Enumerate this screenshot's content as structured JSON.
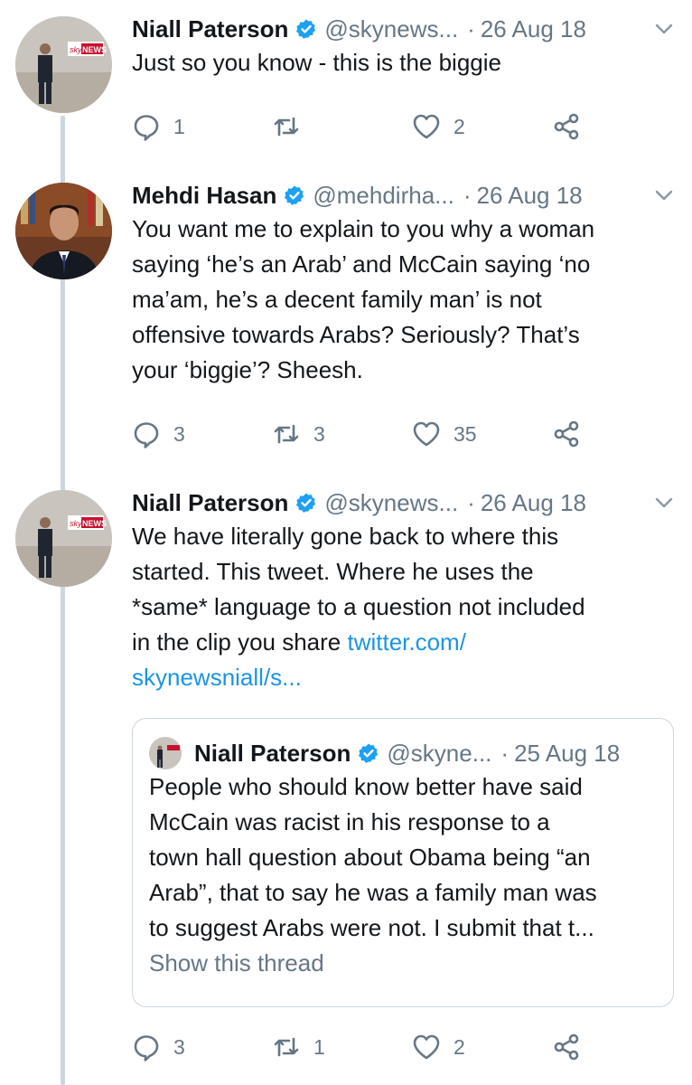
{
  "tweets": [
    {
      "name": "Niall Paterson",
      "handle": "@skynews...",
      "sep": "·",
      "date": "26 Aug 18",
      "text": "Just so you know - this is the biggie",
      "replies": "1",
      "retweets": "",
      "likes": "2"
    },
    {
      "name": "Mehdi Hasan",
      "handle": "@mehdirha...",
      "sep": "·",
      "date": "26 Aug 18",
      "text_lines": [
        "You want me to explain to you why a woman",
        "saying ‘he’s an Arab’ and McCain saying ‘no",
        "ma’am, he’s a decent family man’ is not",
        "offensive towards Arabs? Seriously? That’s",
        "your ‘biggie’? Sheesh."
      ],
      "replies": "3",
      "retweets": "3",
      "likes": "35"
    },
    {
      "name": "Niall Paterson",
      "handle": "@skynews...",
      "sep": "·",
      "date": "26 Aug 18",
      "text_lines": [
        "We have literally gone back to where this",
        "started. This tweet. Where he uses the",
        "*same* language to a question not included"
      ],
      "text_line4_prefix": "in the clip you share ",
      "link_line1": "twitter.com/",
      "link_line2": "skynewsniall/s...",
      "replies": "3",
      "retweets": "1",
      "likes": "2"
    }
  ],
  "quote": {
    "name": "Niall Paterson",
    "handle": "@skyne...",
    "sep": "·",
    "date": "25 Aug 18",
    "text_lines": [
      "People who should know better have said",
      "McCain was racist in his response to a",
      "town hall question about Obama being “an",
      "Arab”, that to say he was a family man was",
      "to suggest Arabs were not. I submit that t..."
    ],
    "show_thread": "Show this thread"
  },
  "avatar_labels": {
    "sky_logo": "sky",
    "sky_news": "NEWS"
  },
  "colors": {
    "link": "#1b95e0",
    "secondary": "#657786",
    "verified": "#1da1f2",
    "thread_line": "#ccd6dd"
  },
  "icons": [
    "verified-badge-icon",
    "chevron-down-icon",
    "reply-icon",
    "retweet-icon",
    "like-icon",
    "share-icon"
  ]
}
